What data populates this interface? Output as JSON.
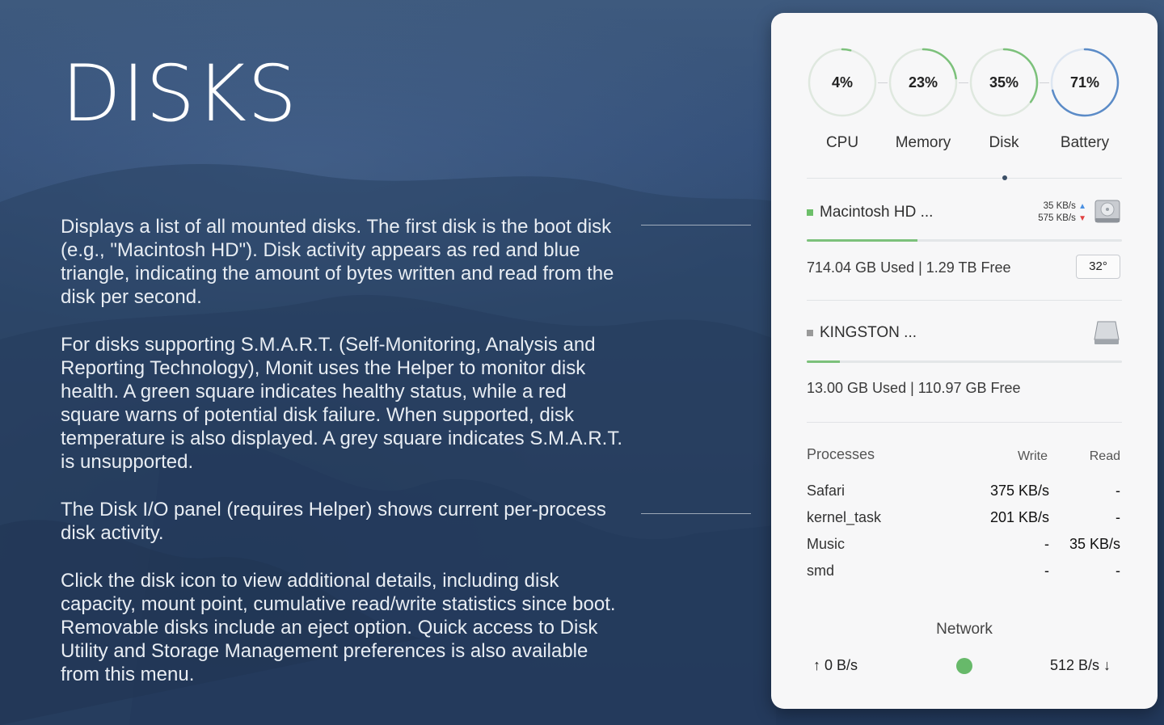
{
  "page": {
    "title": "DISKS",
    "paragraphs": [
      "Displays a list of all mounted disks. The first disk is the boot disk (e.g., \"Macintosh HD\").  Disk activity appears as red and blue triangle, indicating the amount of bytes written and read from the disk per second.",
      "For disks supporting S.M.A.R.T. (Self-Monitoring, Analysis and Reporting Technology), Monit uses the Helper to monitor disk health. A green square indicates healthy status, while a red square warns of potential disk failure. When supported, disk temperature is also displayed. A grey square indicates S.M.A.R.T. is unsupported.",
      "The Disk I/O panel (requires Helper) shows current per-process disk activity.",
      "Click the disk icon to view additional details, including disk capacity, mount point, cumulative read/write statistics since boot. Removable disks include an eject option. Quick access to Disk Utility and Storage Management preferences is also available from this menu."
    ]
  },
  "gauges": [
    {
      "label": "CPU",
      "value": "4%",
      "fraction": 0.04,
      "color": "#7cc17b"
    },
    {
      "label": "Memory",
      "value": "23%",
      "fraction": 0.23,
      "color": "#7cc17b"
    },
    {
      "label": "Disk",
      "value": "35%",
      "fraction": 0.35,
      "color": "#7cc17b"
    },
    {
      "label": "Battery",
      "value": "71%",
      "fraction": 0.71,
      "color": "#5b8bc7"
    }
  ],
  "disks": [
    {
      "name": "Macintosh HD ...",
      "status_color": "#6dbf6a",
      "write_rate": "35 KB/s",
      "read_rate": "575 KB/s",
      "used_fraction": 0.35,
      "usage_text": "714.04 GB Used  |  1.29 TB Free",
      "temperature": "32°",
      "icon": "internal-drive-icon"
    },
    {
      "name": "KINGSTON ...",
      "status_color": "#9a9a9a",
      "used_fraction": 0.105,
      "usage_text": "13.00 GB Used  |  110.97 GB Free",
      "icon": "external-drive-icon"
    }
  ],
  "processes": {
    "header": {
      "name": "Processes",
      "write": "Write",
      "read": "Read"
    },
    "rows": [
      {
        "name": "Safari",
        "write": "375 KB/s",
        "read": "-"
      },
      {
        "name": "kernel_task",
        "write": "201 KB/s",
        "read": "-"
      },
      {
        "name": "Music",
        "write": "-",
        "read": "35 KB/s"
      },
      {
        "name": "smd",
        "write": "-",
        "read": "-"
      }
    ]
  },
  "network": {
    "title": "Network",
    "upload": "0 B/s",
    "download": "512 B/s",
    "status_color": "#67b96a"
  }
}
